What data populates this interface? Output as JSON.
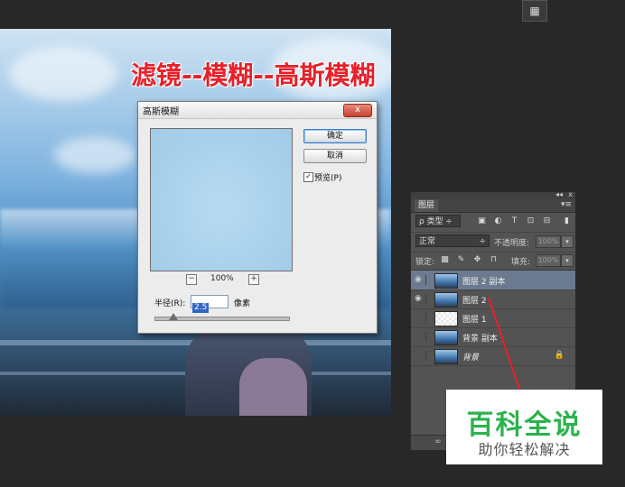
{
  "annotation_title": "滤镜--模糊--高斯模糊",
  "top_icon_symbol": "▦",
  "dialog": {
    "title": "高斯模糊",
    "close_symbol": "x",
    "ok_label": "确定",
    "cancel_label": "取消",
    "preview_checked_symbol": "✓",
    "preview_label": "预览(P)",
    "zoom_out": "−",
    "zoom_value": "100%",
    "zoom_in": "+",
    "radius_label": "半径(R):",
    "radius_value": "2.5",
    "unit_label": "像素"
  },
  "layers_panel": {
    "header_collapse": "◂◂",
    "header_close": "x",
    "tab_label": "图层",
    "menu_symbol": "▾≡",
    "filter_kind": "ρ 类型  ÷",
    "blend_mode": "正常",
    "blend_arrow": "÷",
    "opacity_label": "不透明度:",
    "opacity_value": "100%",
    "lock_label": "锁定:",
    "fill_label": "填充:",
    "fill_value": "100%",
    "dropdown_arrow": "▾",
    "layers": [
      {
        "name": "图层 2 副本",
        "visible": true,
        "selected": true
      },
      {
        "name": "图层 2",
        "visible": true,
        "selected": false
      },
      {
        "name": "图层 1",
        "visible": false,
        "selected": false
      },
      {
        "name": "背景 副本",
        "visible": false,
        "selected": false
      },
      {
        "name": "背景",
        "visible": false,
        "selected": false,
        "locked": true
      }
    ],
    "eye_symbol": "◉",
    "lock_symbol": "🔒",
    "footer_text": "∞"
  },
  "watermark": {
    "big": "百科全说",
    "small": "助你轻松解决"
  },
  "colors": {
    "annotation_red": "#e8202a",
    "watermark_green": "#2bb24c",
    "selection_blue": "#3166c7"
  }
}
